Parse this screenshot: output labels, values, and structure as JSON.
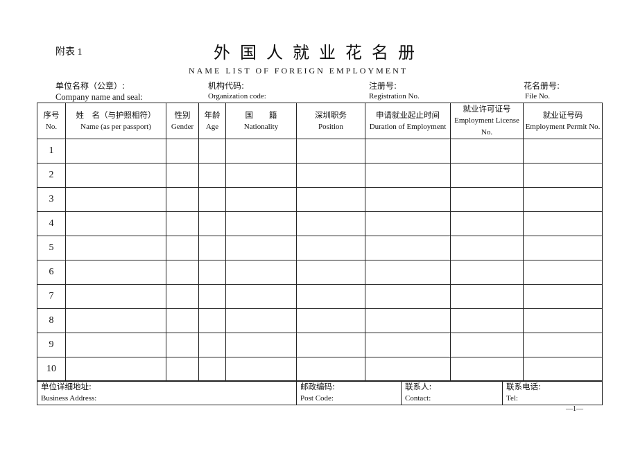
{
  "annex_label": "附表 1",
  "title_cn": "外国人就业花名册",
  "title_en": "NAME LIST OF FOREIGN EMPLOYMENT",
  "header_fields": [
    {
      "cn": "单位名称（公章）:",
      "en": "Company name and seal:"
    },
    {
      "cn": "机构代码:",
      "en": "Organization code:"
    },
    {
      "cn": "注册号:",
      "en": "Registration No."
    },
    {
      "cn": "花名册号:",
      "en": "File No."
    }
  ],
  "columns": [
    {
      "cn": "序号",
      "en": "No."
    },
    {
      "cn": "姓　名（与护照相符）",
      "en": "Name (as per passport)"
    },
    {
      "cn": "性别",
      "en": "Gender"
    },
    {
      "cn": "年龄",
      "en": "Age"
    },
    {
      "cn": "国　　籍",
      "en": "Nationality"
    },
    {
      "cn": "深圳职务",
      "en": "Position"
    },
    {
      "cn": "申请就业起止时间",
      "en": "Duration of Employment"
    },
    {
      "cn": "就业许可证号",
      "en": "Employment License No."
    },
    {
      "cn": "就业证号码",
      "en": "Employment Permit No."
    }
  ],
  "rows": [
    "1",
    "2",
    "3",
    "4",
    "5",
    "6",
    "7",
    "8",
    "9",
    "10"
  ],
  "footer_fields": [
    {
      "cn": "单位详细地址:",
      "en": "Business Address:"
    },
    {
      "cn": "邮政编码:",
      "en": "Post Code:"
    },
    {
      "cn": "联系人:",
      "en": "Contact:"
    },
    {
      "cn": "联系电话:",
      "en": "Tel:"
    }
  ],
  "page_number": "—1—"
}
